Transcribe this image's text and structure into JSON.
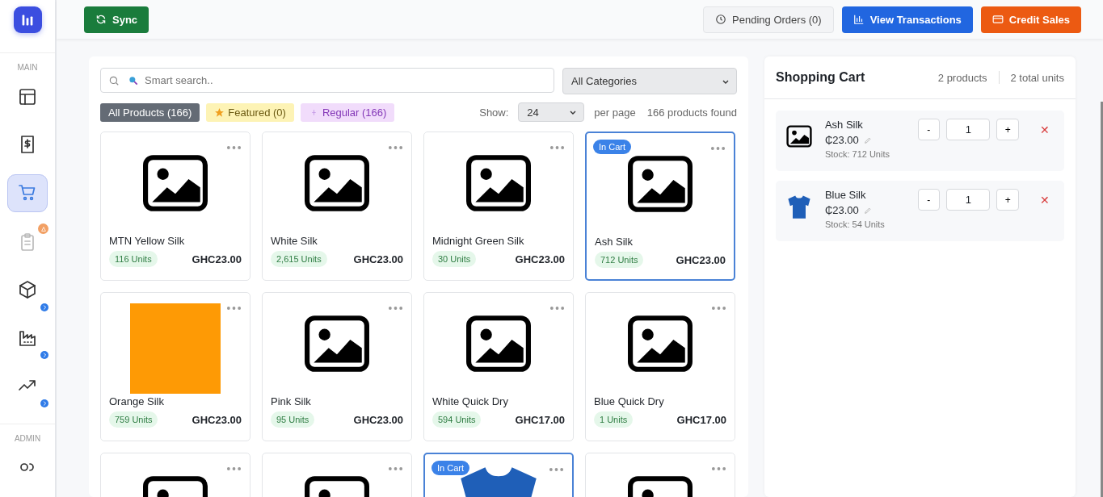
{
  "sidebar": {
    "sections": [
      {
        "title": "MAIN",
        "items": [
          {
            "kind": "plain",
            "selected": false,
            "disabled": false
          },
          {
            "kind": "plain",
            "selected": false,
            "disabled": false
          },
          {
            "kind": "plain",
            "selected": true,
            "disabled": false
          },
          {
            "kind": "warning",
            "selected": false,
            "disabled": true
          },
          {
            "kind": "chevron",
            "selected": false,
            "disabled": false
          },
          {
            "kind": "chevron",
            "selected": false,
            "disabled": false
          },
          {
            "kind": "chevron",
            "selected": false,
            "disabled": false
          }
        ]
      },
      {
        "title": "ADMIN",
        "items": [
          {
            "kind": "plain",
            "selected": false,
            "disabled": false
          }
        ]
      }
    ]
  },
  "topbar": {
    "sync": "Sync",
    "pending": "Pending Orders (0)",
    "transactions": "View Transactions",
    "credit": "Credit Sales"
  },
  "search": {
    "placeholder": "Smart search..",
    "category": "All Categories"
  },
  "filters": [
    {
      "kind": "all",
      "label": "All Products (166)",
      "selected": true
    },
    {
      "kind": "featured",
      "label": "Featured (0)",
      "selected": false
    },
    {
      "kind": "regular",
      "label": "Regular (166)",
      "selected": false
    }
  ],
  "paging": {
    "show_label": "Show:",
    "per_page": "24",
    "per_page_label": "per page",
    "found": "166 products found"
  },
  "products": [
    {
      "name": "MTN Yellow Silk",
      "units": "116 Units",
      "price": "GHC23.00",
      "kind": "placeholder",
      "in_cart": false
    },
    {
      "name": "White Silk",
      "units": "2,615 Units",
      "price": "GHC23.00",
      "kind": "placeholder",
      "in_cart": false
    },
    {
      "name": "Midnight Green Silk",
      "units": "30 Units",
      "price": "GHC23.00",
      "kind": "placeholder",
      "in_cart": false
    },
    {
      "name": "Ash Silk",
      "units": "712 Units",
      "price": "GHC23.00",
      "kind": "placeholder",
      "in_cart": true,
      "badge": "In Cart"
    },
    {
      "name": "Orange Silk",
      "units": "759 Units",
      "price": "GHC23.00",
      "kind": "swatch",
      "in_cart": false
    },
    {
      "name": "Pink Silk",
      "units": "95 Units",
      "price": "GHC23.00",
      "kind": "placeholder",
      "in_cart": false
    },
    {
      "name": "White Quick Dry",
      "units": "594 Units",
      "price": "GHC17.00",
      "kind": "placeholder",
      "in_cart": false
    },
    {
      "name": "Blue Quick Dry",
      "units": "1 Units",
      "price": "GHC17.00",
      "kind": "placeholder",
      "in_cart": false
    },
    {
      "kind": "placeholder",
      "in_cart": false
    },
    {
      "kind": "placeholder",
      "in_cart": false
    },
    {
      "kind": "shirt",
      "in_cart": true,
      "badge": "In Cart"
    },
    {
      "kind": "placeholder",
      "in_cart": false
    }
  ],
  "cart": {
    "title": "Shopping Cart",
    "products": "2 products",
    "units": "2 total units",
    "items": [
      {
        "kind": "placeholder",
        "name": "Ash Silk",
        "price": "₵23.00",
        "stock": "Stock: 712 Units",
        "quantity": "1",
        "minus": "-",
        "plus": "+",
        "remove": "✕"
      },
      {
        "kind": "shirt",
        "name": "Blue Silk",
        "price": "₵23.00",
        "stock": "Stock: 54 Units",
        "quantity": "1",
        "minus": "-",
        "plus": "+",
        "remove": "✕"
      }
    ]
  }
}
